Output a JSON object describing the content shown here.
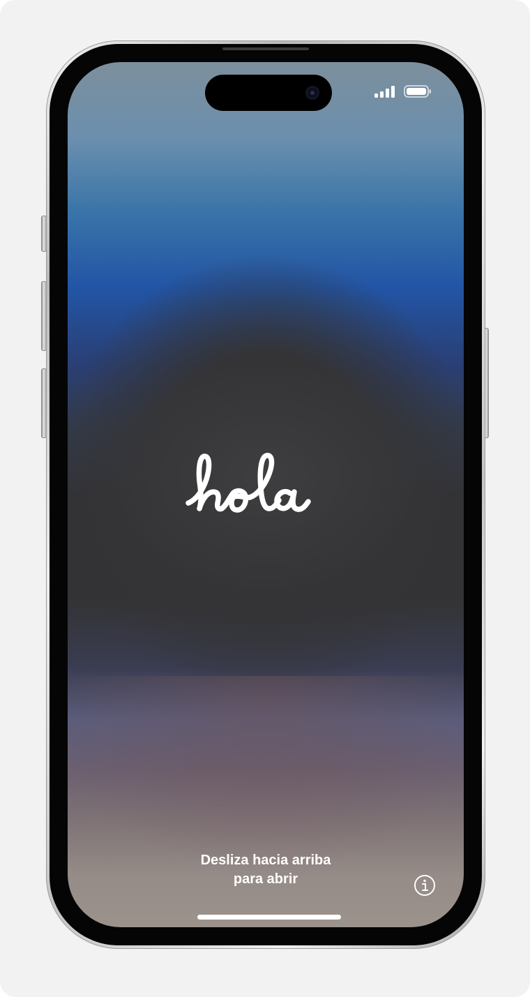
{
  "lock_screen": {
    "greeting": "hola",
    "swipe_line1": "Desliza hacia arriba",
    "swipe_line2": "para abrir"
  },
  "status_bar": {
    "icons": [
      "cellular-signal-icon",
      "battery-icon"
    ]
  },
  "icons": {
    "info": "info-icon"
  },
  "colors": {
    "background": "#f2f2f2",
    "frame": "#c4c4c4",
    "text": "#ffffff"
  }
}
